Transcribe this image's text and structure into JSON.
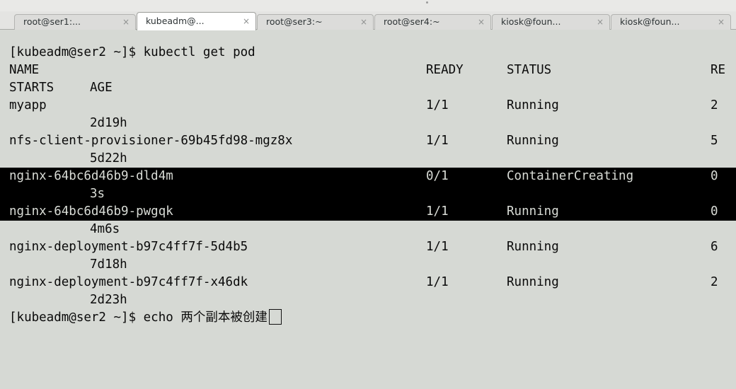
{
  "tabs": [
    {
      "label": "root@ser1:..."
    },
    {
      "label": "kubeadm@..."
    },
    {
      "label": "root@ser3:~"
    },
    {
      "label": "root@ser4:~"
    },
    {
      "label": "kiosk@foun..."
    },
    {
      "label": "kiosk@foun..."
    }
  ],
  "tab_close_glyph": "×",
  "prompt": {
    "first": "[kubeadm@ser2 ~]$ kubectl get pod",
    "last": "[kubeadm@ser2 ~]$ echo 两个副本被创建"
  },
  "headers": {
    "name": "NAME",
    "ready": "READY",
    "status": "STATUS",
    "restarts_part1": "RE",
    "restarts_part2": "STARTS",
    "age": "AGE"
  },
  "pods": [
    {
      "name": "myapp",
      "ready": "1/1",
      "status": "Running",
      "restarts": "2",
      "age": "2d19h",
      "selected": false
    },
    {
      "name": "nfs-client-provisioner-69b45fd98-mgz8x",
      "ready": "1/1",
      "status": "Running",
      "restarts": "5",
      "age": "5d22h",
      "selected": false
    },
    {
      "name": "nginx-64bc6d46b9-dld4m",
      "ready": "0/1",
      "status": "ContainerCreating",
      "restarts": "0",
      "age": "3s",
      "selected": true
    },
    {
      "name": "nginx-64bc6d46b9-pwgqk",
      "ready": "1/1",
      "status": "Running",
      "restarts": "0",
      "age": "4m6s",
      "selected": true
    },
    {
      "name": "nginx-deployment-b97c4ff7f-5d4b5",
      "ready": "1/1",
      "status": "Running",
      "restarts": "6",
      "age": "7d18h",
      "selected": false
    },
    {
      "name": "nginx-deployment-b97c4ff7f-x46dk",
      "ready": "1/1",
      "status": "Running",
      "restarts": "2",
      "age": "2d23h",
      "selected": false
    }
  ]
}
